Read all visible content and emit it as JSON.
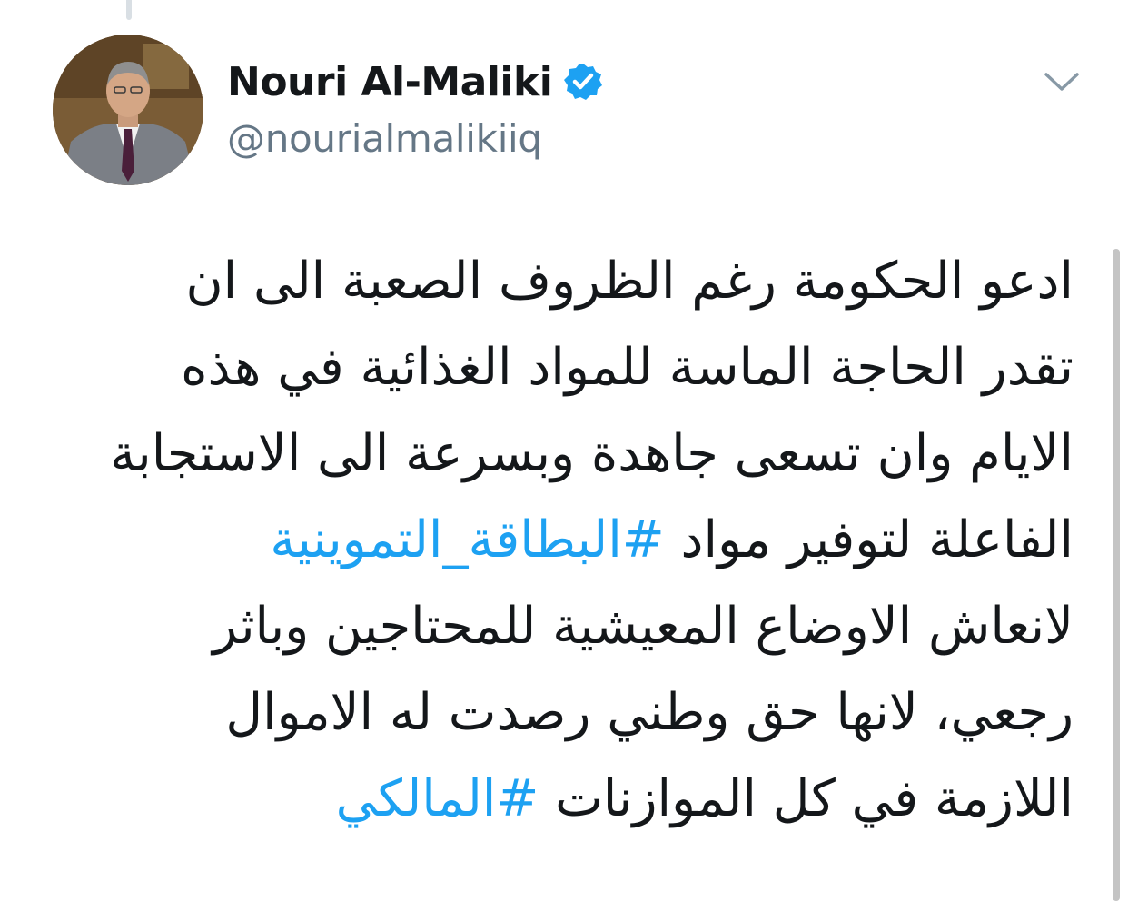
{
  "author": {
    "display_name": "Nouri Al-Maliki",
    "handle": "@nourialmalikiiq",
    "verified": true,
    "avatar_icon": "profile-photo"
  },
  "menu": {
    "icon": "chevron-down-icon"
  },
  "tweet": {
    "lines": [
      {
        "text": "ادعو الحكومة رغم الظروف الصعبة  الى ان"
      },
      {
        "text": "تقدر الحاجة الماسة للمواد الغذائية في هذه"
      },
      {
        "text": "الايام وان تسعى جاهدة وبسرعة الى الاستجابة"
      },
      {
        "text": "الفاعلة لتوفير مواد ",
        "hashtag": "#البطاقة_التموينية"
      },
      {
        "text": "لانعاش الاوضاع المعيشية للمحتاجين وباثر"
      },
      {
        "text": "رجعي، لانها حق وطني رصدت له الاموال"
      },
      {
        "text": "اللازمة في كل الموازنات ",
        "hashtag": "#المالكي"
      }
    ]
  },
  "colors": {
    "text": "#14171a",
    "secondary": "#657786",
    "link": "#1da1f2",
    "verified": "#1da1f2",
    "chevron": "#8899a6"
  }
}
